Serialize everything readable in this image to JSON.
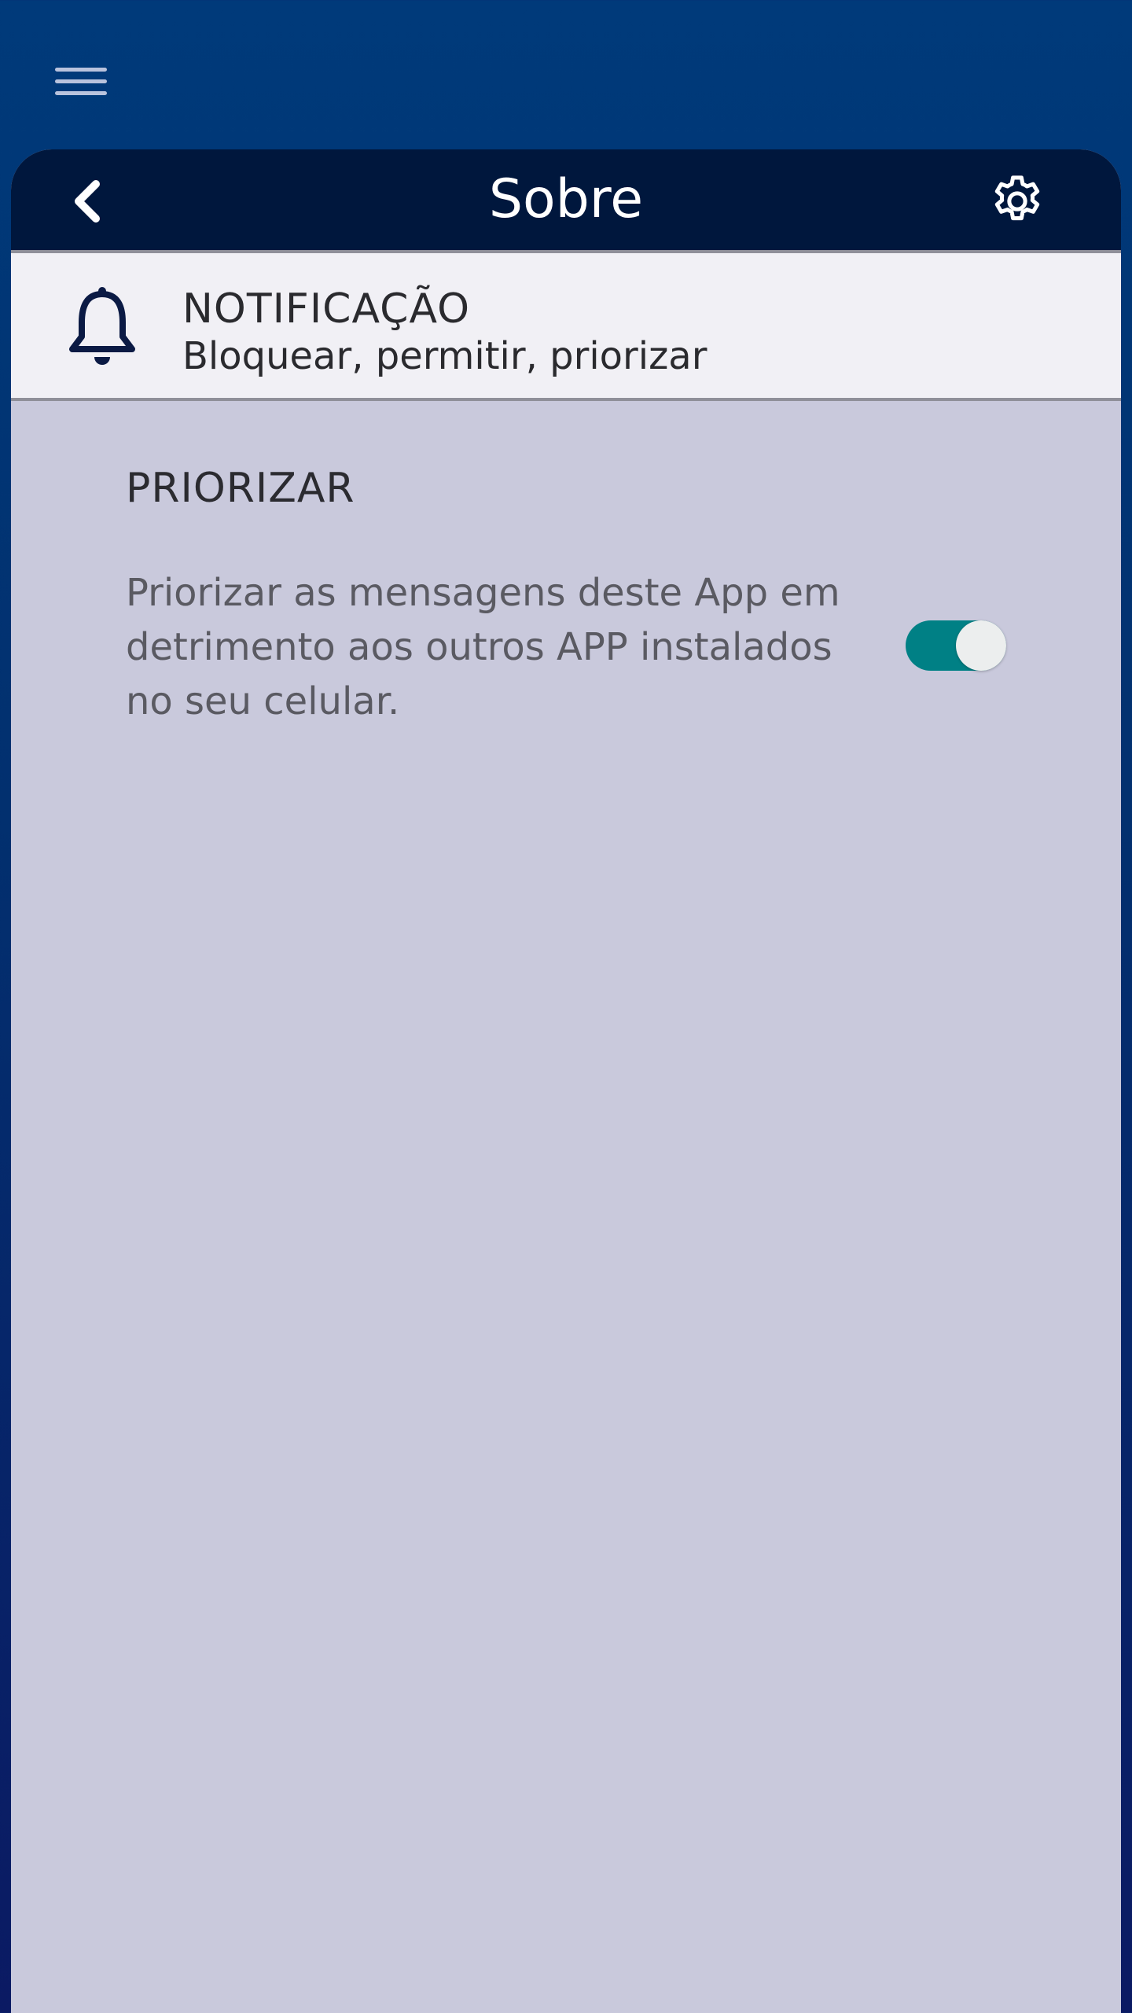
{
  "app_bar": {
    "menu_icon": "hamburger-menu-icon"
  },
  "header": {
    "title": "Sobre",
    "back_icon": "chevron-left-icon",
    "settings_icon": "gear-icon"
  },
  "notification_section": {
    "icon": "bell-icon",
    "title": "NOTIFICAÇÃO",
    "subtitle": "Bloquear, permitir, priorizar"
  },
  "prioritize": {
    "heading": "PRIORIZAR",
    "description": "Priorizar as mensagens deste App em detrimento aos outros APP instalados no seu celular.",
    "toggle_on": true
  },
  "colors": {
    "background_top": "#003a7a",
    "header": "#00173d",
    "card": "#c9c9dc",
    "toggle_on": "#008085"
  }
}
